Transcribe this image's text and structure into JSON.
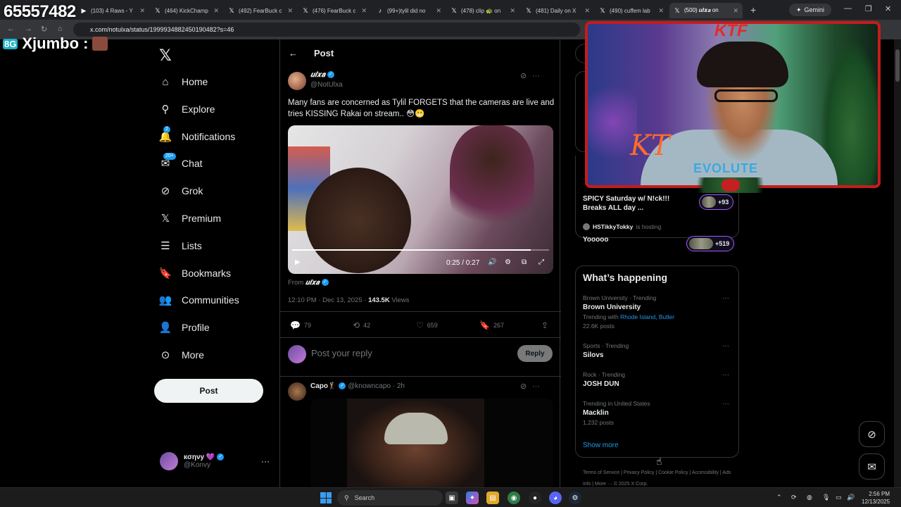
{
  "overlay": {
    "follower_count": "65557482",
    "chat_user": "Xjumbo :",
    "chat_badge": "8G",
    "stream_logo": "KTF",
    "signature": "KT",
    "shirt_text": "EVOLUTE"
  },
  "browser": {
    "tabs": [
      {
        "icon": "youtube-icon",
        "glyph": "▶",
        "title": "(103) 4 Raws - Y"
      },
      {
        "icon": "x-icon",
        "glyph": "𝕏",
        "title": "(464) KickChamp"
      },
      {
        "icon": "x-icon",
        "glyph": "𝕏",
        "title": "(492) FearBuck c"
      },
      {
        "icon": "x-icon",
        "glyph": "𝕏",
        "title": "(476) FearBuck c"
      },
      {
        "icon": "tiktok-icon",
        "glyph": "♪",
        "title": "(99+)tylil did no"
      },
      {
        "icon": "x-icon",
        "glyph": "𝕏",
        "title": "(478) clip 🐢 on"
      },
      {
        "icon": "x-icon",
        "glyph": "𝕏",
        "title": "(481) Daily on X"
      },
      {
        "icon": "x-icon",
        "glyph": "𝕏",
        "title": "(490) cuffem lab"
      },
      {
        "icon": "x-icon",
        "glyph": "𝕏",
        "title": "(500) 𝒖𝒍𝒙𝒂 on",
        "active": true
      }
    ],
    "gemini_label": "Gemini",
    "url": "x.com/notulxa/status/1999934882450190482?s=46"
  },
  "sidebar": {
    "logo": "𝕏",
    "items": [
      {
        "label": "Home",
        "icon": "home-icon",
        "glyph": "⌂"
      },
      {
        "label": "Explore",
        "icon": "search-icon",
        "glyph": "⚲"
      },
      {
        "label": "Notifications",
        "icon": "bell-icon",
        "glyph": "🔔",
        "badge": "2"
      },
      {
        "label": "Chat",
        "icon": "chat-icon",
        "glyph": "✉",
        "badge": "20+"
      },
      {
        "label": "Grok",
        "icon": "grok-icon",
        "glyph": "⊘"
      },
      {
        "label": "Premium",
        "icon": "x-premium-icon",
        "glyph": "𝕏"
      },
      {
        "label": "Lists",
        "icon": "lists-icon",
        "glyph": "☰"
      },
      {
        "label": "Bookmarks",
        "icon": "bookmark-icon",
        "glyph": "🔖"
      },
      {
        "label": "Communities",
        "icon": "communities-icon",
        "glyph": "👥"
      },
      {
        "label": "Profile",
        "icon": "profile-icon",
        "glyph": "👤"
      },
      {
        "label": "More",
        "icon": "more-icon",
        "glyph": "⊙"
      }
    ],
    "post_button": "Post",
    "account": {
      "name": "кσηνу 💜",
      "handle": "@Konvy"
    }
  },
  "post": {
    "header_title": "Post",
    "author_name": "𝒖𝒍𝒙𝒂",
    "author_handle": "@NotUlxa",
    "text": "Many fans are concerned as Tylil FORGETS that the cameras are live and tries KISSING Rakai on stream.. 😳😬",
    "video_time": "0:25 / 0:27",
    "video_progress": 0.93,
    "from_label": "From",
    "from_name": "𝒖𝒍𝒙𝒂",
    "timestamp": "12:10 PM · Dec 13, 2025 · ",
    "views_count": "143.5K",
    "views_label": " Views",
    "stats": {
      "replies": "79",
      "reposts": "42",
      "likes": "659",
      "bookmarks": "267"
    },
    "reply_placeholder": "Post your reply",
    "reply_button": "Reply"
  },
  "comment": {
    "name": "Capo🏌",
    "handle": "@knowncapo · 2h"
  },
  "right": {
    "live": [
      {
        "title": "SPICY Saturday w/ N!ck!!!",
        "subtitle": "Breaks ALL day ...",
        "count": "+93"
      },
      {
        "host": "HSTikkyTokky",
        "host_suffix": " is hosting",
        "title": "Yooooo",
        "count": "+519"
      }
    ],
    "whats_happening": "What’s happening",
    "trends": [
      {
        "context": "Brown University · Trending",
        "name": "Brown University",
        "sub_prefix": "Trending with ",
        "sub_links": "Rhode Island, Butler",
        "posts": "22.6K posts"
      },
      {
        "context": "Sports · Trending",
        "name": "Silovs"
      },
      {
        "context": "Rock · Trending",
        "name": "JOSH DUN"
      },
      {
        "context": "Trending in United States",
        "name": "Macklin",
        "posts": "1,232 posts"
      }
    ],
    "show_more": "Show more",
    "footer": "Terms of Service  |  Privacy Policy  |  Cookie Policy  |  Accessibility  |  Ads info  |  More ···  © 2025 X Corp."
  },
  "taskbar": {
    "search": "Search",
    "time": "2:56 PM",
    "date": "12/13/2025"
  }
}
